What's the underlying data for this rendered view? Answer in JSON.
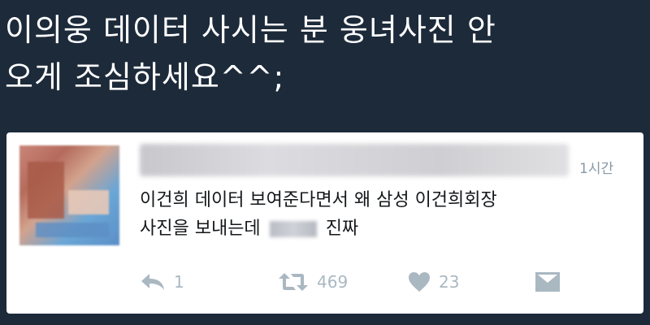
{
  "headline": {
    "line1": "이의웅 데이터 사시는 분 웅녀사진 안",
    "line2": "오게 조심하세요^^;"
  },
  "tweet": {
    "time": "1시간",
    "text_line1": "이건희 데이터 보여준다면서 왜 삼성 이건희회장",
    "text_line2_before": "사진을 보내는데",
    "text_line2_after": "진짜",
    "actions": {
      "reply_count": "1",
      "retweet_count": "469",
      "like_count": "23"
    }
  },
  "colors": {
    "background": "#1c2a3a",
    "card": "#ffffff",
    "muted": "#aab8c2",
    "text": "#14171a"
  },
  "icons": [
    "reply-icon",
    "retweet-icon",
    "like-icon",
    "dm-icon"
  ]
}
